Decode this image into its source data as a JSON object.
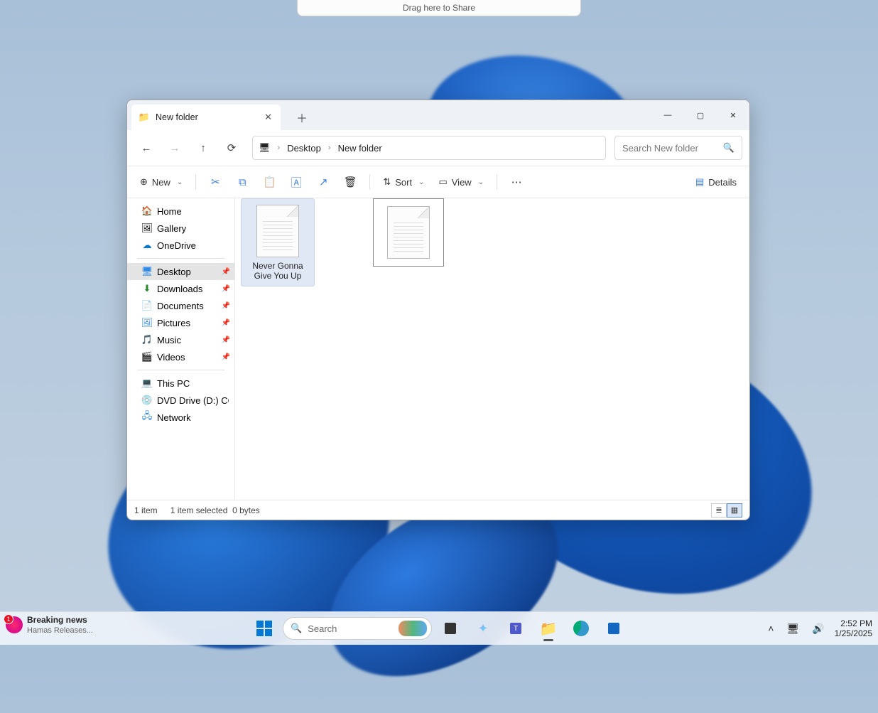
{
  "share_drop": "Drag here to Share",
  "window": {
    "tab_title": "New folder",
    "breadcrumb": {
      "seg1": "Desktop",
      "seg2": "New folder"
    },
    "search_placeholder": "Search New folder",
    "toolbar": {
      "new": "New",
      "sort": "Sort",
      "view": "View",
      "details": "Details"
    },
    "sidebar": {
      "home": "Home",
      "gallery": "Gallery",
      "onedrive": "OneDrive",
      "desktop": "Desktop",
      "downloads": "Downloads",
      "documents": "Documents",
      "pictures": "Pictures",
      "music": "Music",
      "videos": "Videos",
      "thispc": "This PC",
      "dvd": "DVD Drive (D:) CCCC",
      "network": "Network"
    },
    "files": {
      "item1_name": "Never Gonna Give You Up"
    },
    "status": {
      "count": "1 item",
      "selected": "1 item selected",
      "size": "0 bytes"
    }
  },
  "taskbar": {
    "news_badge": "1",
    "news_title": "Breaking news",
    "news_sub": "Hamas Releases...",
    "search_placeholder": "Search",
    "time": "2:52 PM",
    "date": "1/25/2025"
  }
}
